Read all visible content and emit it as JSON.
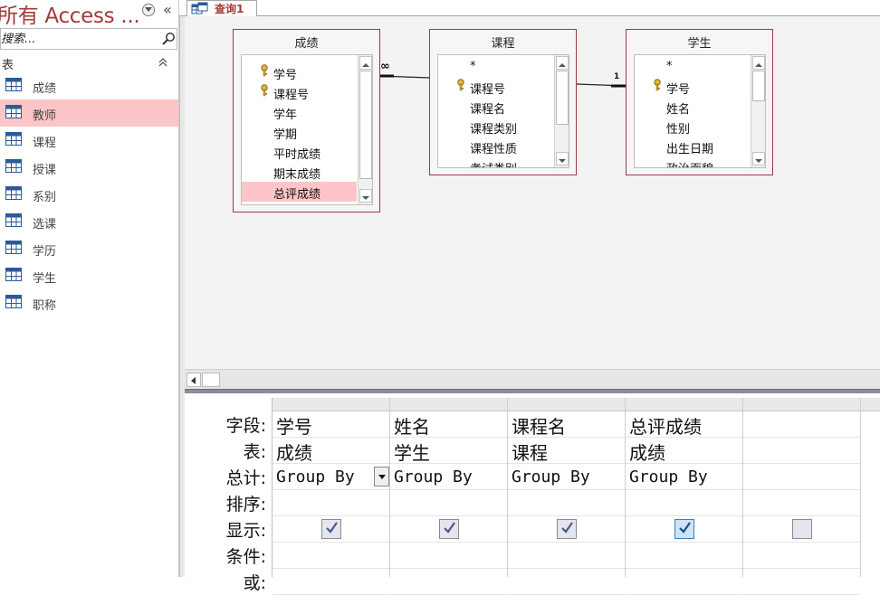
{
  "nav": {
    "title": "所有 Access ...",
    "search_placeholder": "搜索...",
    "group_label": "表",
    "items": [
      {
        "label": "成绩",
        "selected": false
      },
      {
        "label": "教师",
        "selected": true
      },
      {
        "label": "课程",
        "selected": false
      },
      {
        "label": "授课",
        "selected": false
      },
      {
        "label": "系别",
        "selected": false
      },
      {
        "label": "选课",
        "selected": false
      },
      {
        "label": "学历",
        "selected": false
      },
      {
        "label": "学生",
        "selected": false
      },
      {
        "label": "职称",
        "selected": false
      }
    ]
  },
  "tab": {
    "label": "查询1"
  },
  "tables": {
    "chengji": {
      "title": "成绩",
      "fields": [
        {
          "label": "*",
          "key": false
        },
        {
          "label": "学号",
          "key": true
        },
        {
          "label": "课程号",
          "key": true
        },
        {
          "label": "学年",
          "key": false
        },
        {
          "label": "学期",
          "key": false
        },
        {
          "label": "平时成绩",
          "key": false
        },
        {
          "label": "期末成绩",
          "key": false
        },
        {
          "label": "总评成绩",
          "key": false,
          "selected": true
        }
      ]
    },
    "kecheng": {
      "title": "课程",
      "fields": [
        {
          "label": "*",
          "key": false
        },
        {
          "label": "课程号",
          "key": true
        },
        {
          "label": "课程名",
          "key": false
        },
        {
          "label": "课程类别",
          "key": false
        },
        {
          "label": "课程性质",
          "key": false
        },
        {
          "label": "考试类别",
          "key": false
        }
      ]
    },
    "xuesheng": {
      "title": "学生",
      "fields": [
        {
          "label": "*",
          "key": false
        },
        {
          "label": "学号",
          "key": true
        },
        {
          "label": "姓名",
          "key": false
        },
        {
          "label": "性别",
          "key": false
        },
        {
          "label": "出生日期",
          "key": false
        },
        {
          "label": "政治面貌",
          "key": false
        }
      ]
    }
  },
  "relations": {
    "many_symbol": "∞",
    "one_symbol": "1"
  },
  "grid": {
    "row_labels": [
      "字段:",
      "表:",
      "总计:",
      "排序:",
      "显示:",
      "条件:",
      "或:"
    ],
    "columns": [
      {
        "field": "学号",
        "table": "成绩",
        "total": "Group By",
        "show": true,
        "active": false
      },
      {
        "field": "姓名",
        "table": "学生",
        "total": "Group By",
        "show": true,
        "active": false
      },
      {
        "field": "课程名",
        "table": "课程",
        "total": "Group By",
        "show": true,
        "active": false
      },
      {
        "field": "总评成绩",
        "table": "成绩",
        "total": "Group By",
        "show": true,
        "active": true
      },
      {
        "field": "",
        "table": "",
        "total": "",
        "show": false,
        "active": false
      }
    ]
  },
  "colors": {
    "accent": "#a33a3a",
    "selection": "#fcc5c7",
    "table_border": "#9b3c43"
  }
}
